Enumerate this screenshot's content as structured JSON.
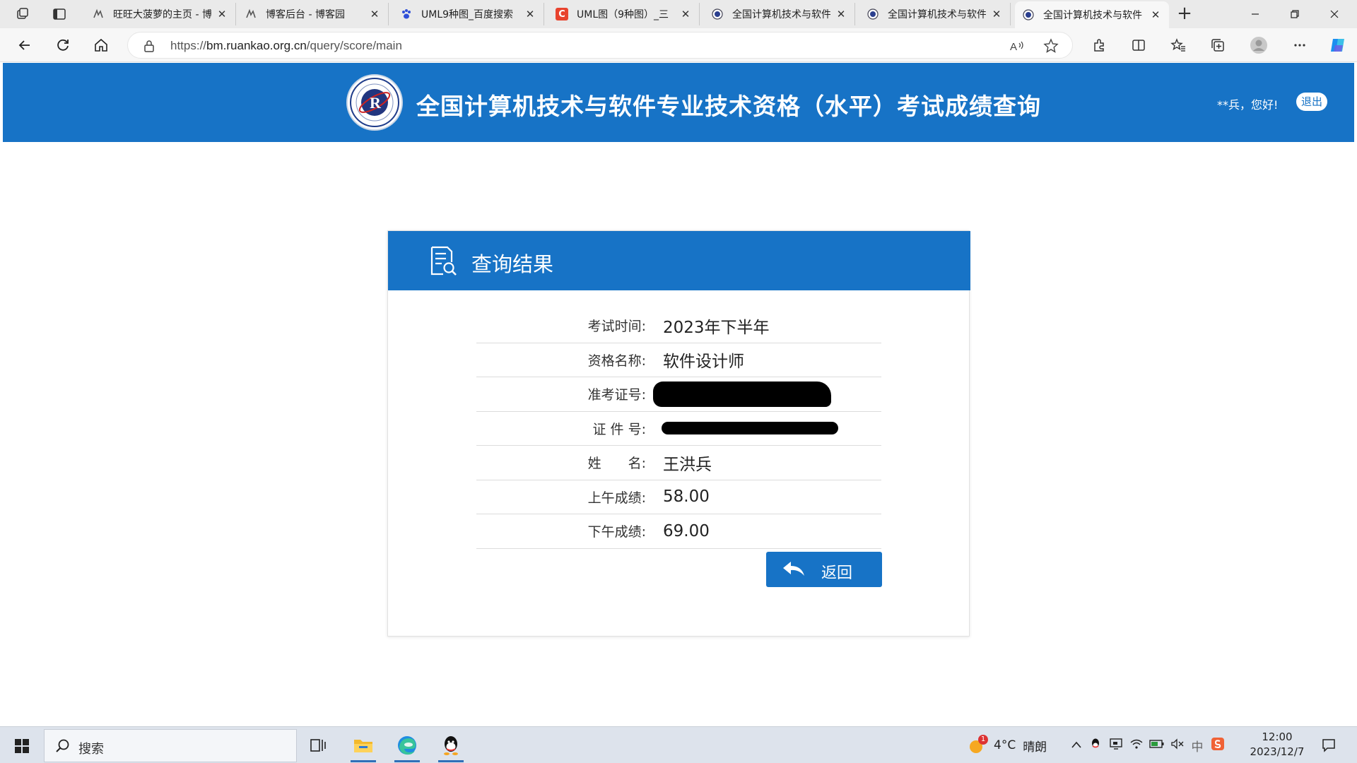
{
  "browser": {
    "tabs": [
      {
        "title": "旺旺大菠萝的主页 - 博",
        "icon": "cnblogs-icon",
        "active": false
      },
      {
        "title": "博客后台 - 博客园",
        "icon": "cnblogs-icon",
        "active": false
      },
      {
        "title": "UML9种图_百度搜索",
        "icon": "baidu-paw-icon",
        "active": false
      },
      {
        "title": "UML图（9种图）_三",
        "icon": "csdn-c-icon",
        "active": false
      },
      {
        "title": "全国计算机技术与软件",
        "icon": "ruankao-icon",
        "active": false
      },
      {
        "title": "全国计算机技术与软件",
        "icon": "ruankao-icon",
        "active": false
      },
      {
        "title": "全国计算机技术与软件",
        "icon": "ruankao-icon",
        "active": true
      }
    ],
    "url_prefix": "https://",
    "url_host": "bm.ruankao.org.cn",
    "url_path": "/query/score/main"
  },
  "header": {
    "title": "全国计算机技术与软件专业技术资格（水平）考试成绩查询",
    "greeting": "**兵，您好!",
    "logout_label": "退出",
    "brand_color": "#1773c6"
  },
  "result": {
    "title": "查询结果",
    "rows": [
      {
        "label": "考试时间:",
        "value": "2023年下半年"
      },
      {
        "label": "资格名称:",
        "value": "软件设计师"
      },
      {
        "label": "准考证号:",
        "value": ""
      },
      {
        "label": "证 件 号:",
        "value": ""
      },
      {
        "label": "姓　　名:",
        "value": "王洪兵"
      },
      {
        "label": "上午成绩:",
        "value": "58.00"
      },
      {
        "label": "下午成绩:",
        "value": "69.00"
      }
    ],
    "back_label": "返回"
  },
  "taskbar": {
    "search_placeholder": "搜索",
    "weather_temp": "4°C",
    "weather_text": "晴朗",
    "weather_badge": "1",
    "ime_label": "中",
    "time": "12:00",
    "date": "2023/12/7"
  }
}
